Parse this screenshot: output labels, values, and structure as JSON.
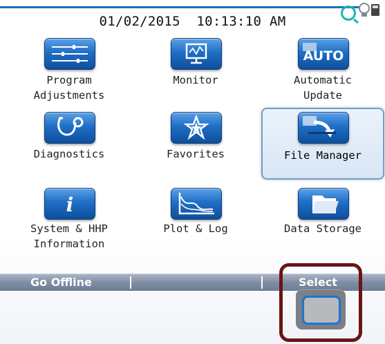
{
  "header": {
    "date": "01/02/2015",
    "time": "10:13:10 AM"
  },
  "tiles": [
    {
      "label_line1": "Program",
      "label_line2": "Adjustments",
      "icon": "sliders-icon"
    },
    {
      "label_line1": "Monitor",
      "label_line2": "",
      "icon": "monitor-icon"
    },
    {
      "label_line1": "Automatic",
      "label_line2": "Update",
      "icon": "auto-icon",
      "icon_text": "AUTO"
    },
    {
      "label_line1": "Diagnostics",
      "label_line2": "",
      "icon": "stethoscope-icon"
    },
    {
      "label_line1": "Favorites",
      "label_line2": "",
      "icon": "star-icon"
    },
    {
      "label_line1": "File Manager",
      "label_line2": "",
      "icon": "file-transfer-icon",
      "selected": true
    },
    {
      "label_line1": "System & HHP",
      "label_line2": "Information",
      "icon": "info-icon",
      "icon_text": "i"
    },
    {
      "label_line1": "Plot & Log",
      "label_line2": "",
      "icon": "chart-icon"
    },
    {
      "label_line1": "Data Storage",
      "label_line2": "",
      "icon": "folder-icon"
    }
  ],
  "softkeys": {
    "left": "Go Offline",
    "middle": "",
    "right": "Select"
  },
  "colors": {
    "header_line": "#1d6fb8",
    "icon_blue": "#1f6ec6",
    "softkey_bar": "#7f8da4",
    "highlight_box": "#6b1414"
  }
}
